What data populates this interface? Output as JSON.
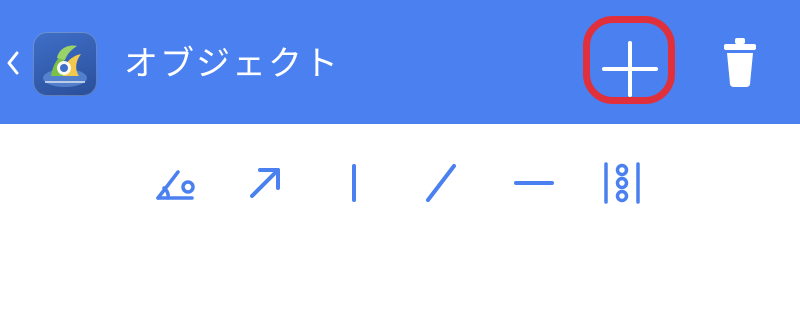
{
  "app_bar": {
    "title": "オブジェクト",
    "background": "#4a80f0",
    "back_icon": "chevron-left-icon",
    "app_icon": "metatrader-app-icon",
    "add_icon": "plus-icon",
    "delete_icon": "trash-icon",
    "highlight_color": "#e0303c"
  },
  "tools": {
    "color": "#4a80f0",
    "items": [
      {
        "icon": "gann-angle-icon"
      },
      {
        "icon": "arrow-icon"
      },
      {
        "icon": "vertical-line-icon"
      },
      {
        "icon": "trend-line-icon"
      },
      {
        "icon": "horizontal-line-icon"
      },
      {
        "icon": "fibonacci-icon"
      }
    ]
  }
}
